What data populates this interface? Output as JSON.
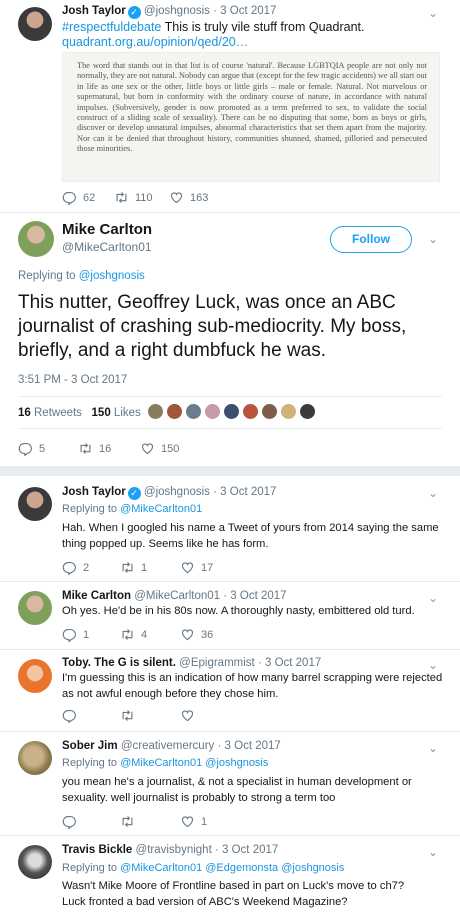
{
  "tweet1": {
    "name": "Josh Taylor",
    "handle": "@joshgnosis",
    "date": "3 Oct 2017",
    "hashtag": "#respectfuldebate",
    "text": " This is truly vile stuff from Quadrant.",
    "link": "quadrant.org.au/opinion/qed/20…",
    "quote_text": "The word that stands out in that list is of course 'natural'.  Because LGBTQIA people are not only not normally, they are not natural.  Nobody can argue that (except for the few tragic accidents) we all start out in life as one sex or the other, little boys or little girls – male or female. Natural. Not marvelous or supernatural, but born in conformity with the ordinary course of nature, in accordance with natural impulses. (Subversively, gender is now promoted as a term preferred to sex, to validate the social construct of a sliding scale of sexuality). There can be no disputing that some, born as boys or girls, discover or develop unnatural impulses, abnormal characteristics that set them apart from the majority. Nor can it be denied that throughout history, communities shunned, shamed, pilloried and persecuted those minorities.",
    "replies": "62",
    "retweets": "110",
    "likes": "163"
  },
  "main": {
    "name": "Mike Carlton",
    "handle": "@MikeCarlton01",
    "follow_label": "Follow",
    "replying_prefix": "Replying to ",
    "replying_to": "@joshgnosis",
    "text": "This nutter, Geoffrey Luck, was once an ABC journalist of crashing sub-mediocrity.  My boss, briefly, and a right dumbfuck he was.",
    "datetime": "3:51 PM - 3 Oct 2017",
    "retweets_count": "16",
    "retweets_label": "Retweets",
    "likes_count": "150",
    "likes_label": "Likes",
    "replies": "5",
    "retweets": "16",
    "likes": "150"
  },
  "replies": [
    {
      "name": "Josh Taylor",
      "handle": "@joshgnosis",
      "date": "3 Oct 2017",
      "verified": true,
      "replying_prefix": "Replying to ",
      "replying_to": "@MikeCarlton01",
      "text": "Hah. When I googled his name a Tweet of yours from 2014 saying the same thing popped up. Seems like he has form.",
      "replies": "2",
      "retweets": "1",
      "likes": "17"
    },
    {
      "name": "Mike Carlton",
      "handle": "@MikeCarlton01",
      "date": "3 Oct 2017",
      "text": "Oh yes. He'd be in his 80s now. A thoroughly nasty, embittered old turd.",
      "replies": "1",
      "retweets": "4",
      "likes": "36"
    },
    {
      "name": "Toby. The G is silent.",
      "handle": "@Epigrammist",
      "date": "3 Oct 2017",
      "text": "I'm guessing this is an indication of how many barrel scrapping were rejected as not awful enough before they chose him.",
      "replies": "",
      "retweets": "",
      "likes": ""
    },
    {
      "name": "Sober Jim",
      "handle": "@creativemercury",
      "date": "3 Oct 2017",
      "replying_prefix": "Replying to ",
      "replying_to": "@MikeCarlton01 @joshgnosis",
      "text": "you mean he's a journalist, & not a specialist in human development or sexuality. well journalist is probably to strong a term too",
      "replies": "",
      "retweets": "",
      "likes": "1"
    },
    {
      "name": "Travis Bickle",
      "handle": "@travisbynight",
      "date": "3 Oct 2017",
      "replying_prefix": "Replying to ",
      "replying_to": "@MikeCarlton01 @Edgemonsta @joshgnosis",
      "text": "Wasn't Mike Moore of Frontline based in part on Luck's move to ch7? Luck fronted a bad version of ABC's Weekend Magazine?"
    }
  ],
  "separator": "·",
  "colors": {
    "accent": "#1da1f2",
    "link": "#1b95e0",
    "muted": "#657786",
    "text": "#14171a"
  },
  "icons": [
    "reply-icon",
    "retweet-icon",
    "like-icon",
    "chevron-down-icon",
    "verified-icon"
  ]
}
